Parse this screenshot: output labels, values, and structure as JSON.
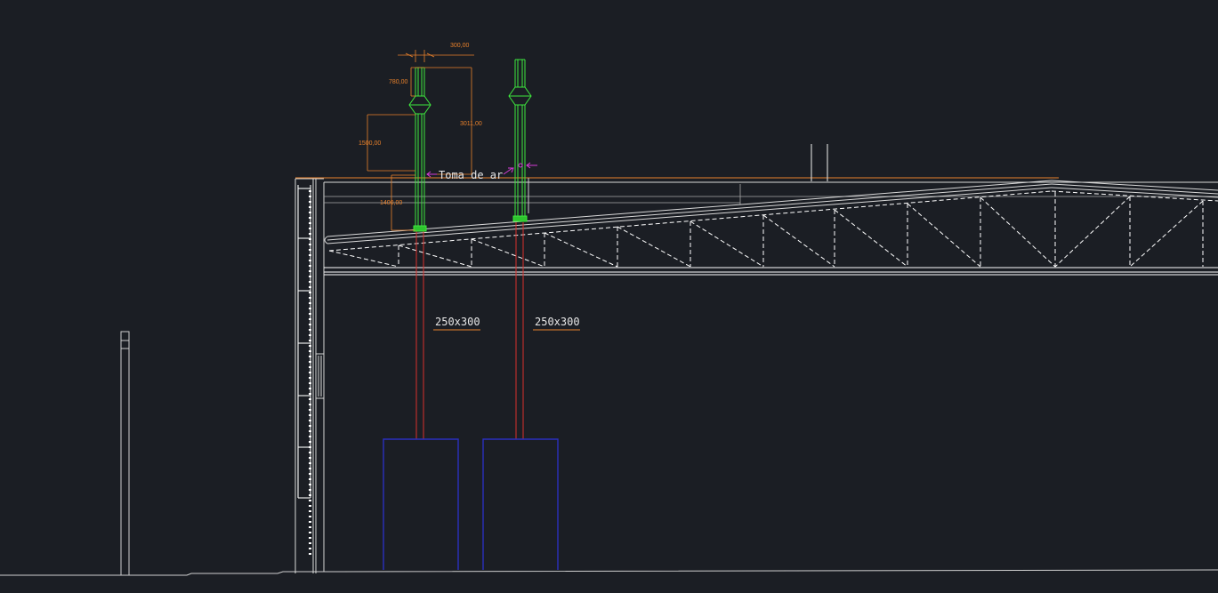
{
  "drawing": {
    "background": "#1b1e24",
    "colors": {
      "structure": "#d9d9d9",
      "chimney": "#3ee83e",
      "duct": "#d9302c",
      "dimension": "#e8812b",
      "marker": "#d63cd6",
      "equipment": "#2a2fbf"
    },
    "annotation_label": "Toma de ar",
    "duct_labels": [
      "250x300",
      "250x300"
    ],
    "dimensions": {
      "width_top": "300,00",
      "cap_height": "780,00",
      "total_height": "3011,00",
      "mid_height": "1500,00",
      "base_height": "1400,00"
    },
    "icons": [
      "arrow-left-icon",
      "arrow-left-icon",
      "arrow-left-icon"
    ]
  }
}
